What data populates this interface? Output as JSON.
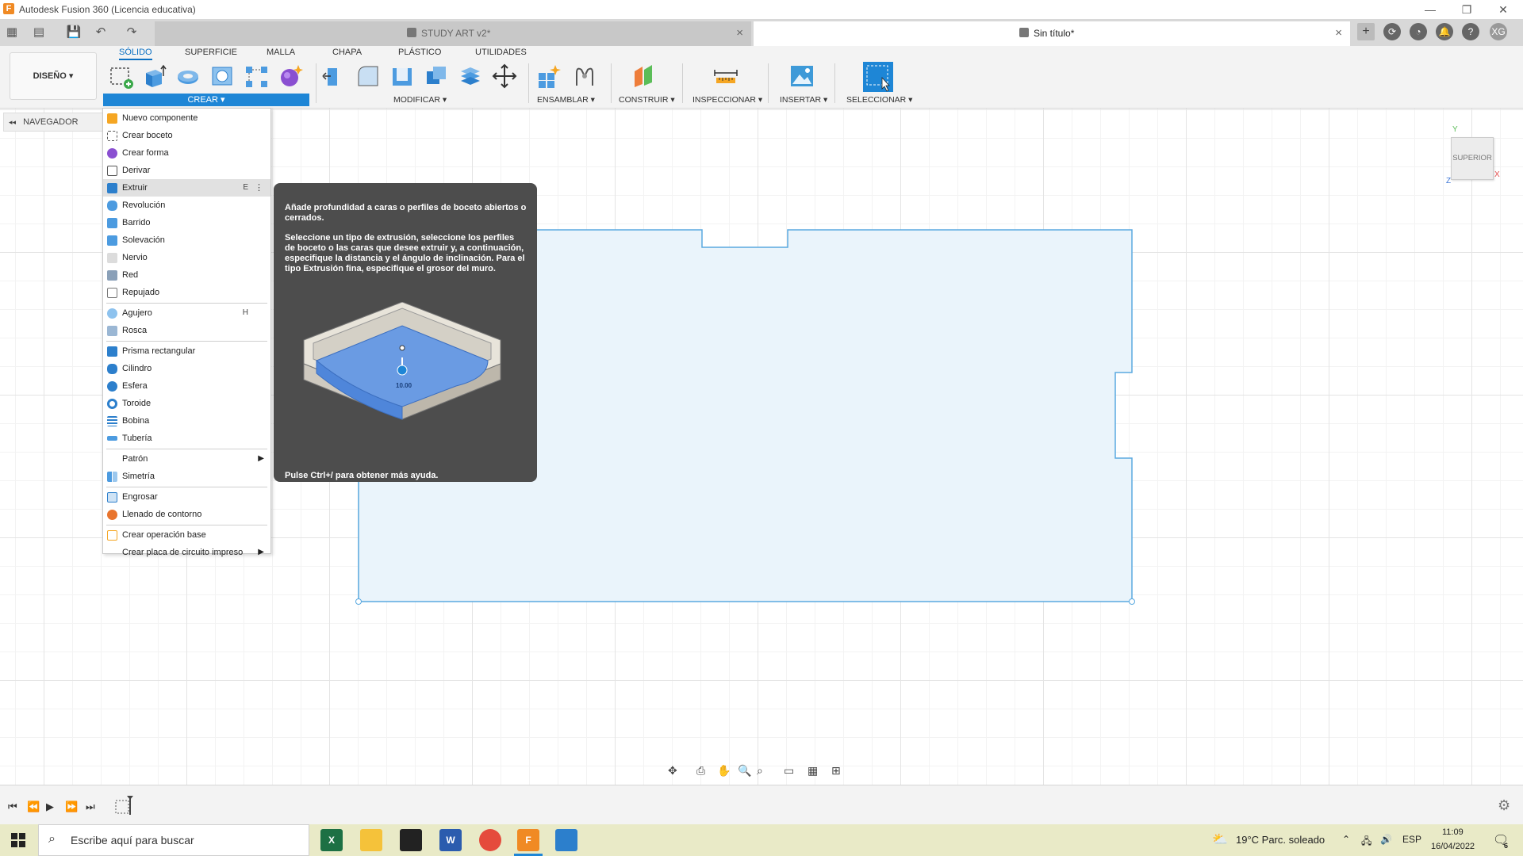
{
  "window": {
    "title": "Autodesk Fusion 360 (Licencia educativa)",
    "logo_letter": "F",
    "controls": [
      "—",
      "❐",
      "✕"
    ]
  },
  "tabs": [
    {
      "label": "STUDY ART v2*",
      "active": false
    },
    {
      "label": "Sin título*",
      "active": true
    }
  ],
  "user_initials": "XG",
  "workspace": "DISEÑO ▾",
  "ribbon_tabs": [
    "SÓLIDO",
    "SUPERFICIE",
    "MALLA",
    "CHAPA",
    "PLÁSTICO",
    "UTILIDADES"
  ],
  "groups": {
    "crear": "CREAR ▾",
    "modificar": "MODIFICAR ▾",
    "ensamblar": "ENSAMBLAR ▾",
    "construir": "CONSTRUIR ▾",
    "inspeccionar": "INSPECCIONAR ▾",
    "insertar": "INSERTAR ▾",
    "seleccionar": "SELECCIONAR ▾"
  },
  "navigator": "NAVEGADOR",
  "view_cube": {
    "face": "SUPERIOR",
    "axes": [
      "Y",
      "X",
      "Z"
    ]
  },
  "crear_menu": [
    {
      "label": "Nuevo componente"
    },
    {
      "label": "Crear boceto"
    },
    {
      "label": "Crear forma"
    },
    {
      "label": "Derivar"
    },
    {
      "label": "Extruir",
      "shortcut": "E",
      "more": "⋮",
      "highlighted": true
    },
    {
      "label": "Revolución"
    },
    {
      "label": "Barrido"
    },
    {
      "label": "Solevación"
    },
    {
      "label": "Nervio"
    },
    {
      "label": "Red"
    },
    {
      "label": "Repujado"
    },
    {
      "label": "Agujero",
      "shortcut": "H"
    },
    {
      "label": "Rosca"
    },
    {
      "label": "Prisma rectangular"
    },
    {
      "label": "Cilindro"
    },
    {
      "label": "Esfera"
    },
    {
      "label": "Toroide"
    },
    {
      "label": "Bobina"
    },
    {
      "label": "Tubería"
    },
    {
      "label": "Patrón",
      "arrow": "▶"
    },
    {
      "label": "Simetría"
    },
    {
      "label": "Engrosar"
    },
    {
      "label": "Llenado de contorno"
    },
    {
      "label": "Crear operación base"
    },
    {
      "label": "Crear placa de circuito impreso",
      "arrow": "▶"
    }
  ],
  "tooltip": {
    "line1": "Añade profundidad a caras o perfiles de boceto abiertos o cerrados.",
    "line2": "Seleccione un tipo de extrusión, seleccione los perfiles de boceto o las caras que desee extruir y, a continuación, especifique la distancia y el ángulo de inclinación. Para el tipo Extrusión fina, especifique el grosor del muro.",
    "dimension": "10.00",
    "help": "Pulse Ctrl+/ para obtener más ayuda."
  },
  "taskbar": {
    "search_placeholder": "Escribe aquí para buscar",
    "weather": "19°C  Parc. soleado",
    "lang": "ESP",
    "time": "11:09",
    "date": "16/04/2022",
    "notifications": "6"
  },
  "colors": {
    "accent": "#1e86d6",
    "sketch_fill": "#eaf4fb",
    "sketch_line": "#5aa9e0",
    "tooltip_bg": "#4d4d4d"
  }
}
